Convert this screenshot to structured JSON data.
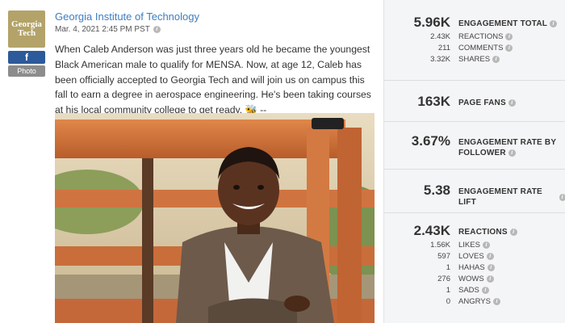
{
  "post": {
    "logo_line1": "Georgia",
    "logo_line2": "Tech",
    "network_badge": "f",
    "type_badge": "Photo",
    "org_name": "Georgia Institute of Technology",
    "timestamp": "Mar. 4, 2021 2:45 PM PST",
    "text": "When Caleb Anderson was just three years old he became the youngest Black American male to qualify for MENSA. Now, at age 12, Caleb has been officially accepted to Georgia Tech and will join us on campus this fall to earn a degree in aerospace engineering. He's been taking courses at his local community college to get ready. 🐝 -- http://c.gatech.edu/MeetCaleb",
    "photo_icon": "photo-of-smiling-boy"
  },
  "metrics": {
    "engagement_total": {
      "value": "5.96K",
      "label": "ENGAGEMENT TOTAL",
      "rows": [
        {
          "value": "2.43K",
          "label": "REACTIONS"
        },
        {
          "value": "211",
          "label": "COMMENTS"
        },
        {
          "value": "3.32K",
          "label": "SHARES"
        }
      ]
    },
    "page_fans": {
      "value": "163K",
      "label": "PAGE FANS"
    },
    "engagement_rate": {
      "value": "3.67%",
      "label_line1": "ENGAGEMENT RATE BY",
      "label_line2": "FOLLOWER"
    },
    "engagement_lift": {
      "value": "5.38",
      "label": "ENGAGEMENT RATE LIFT"
    },
    "reactions": {
      "value": "2.43K",
      "label": "REACTIONS",
      "rows": [
        {
          "value": "1.56K",
          "label": "LIKES"
        },
        {
          "value": "597",
          "label": "LOVES"
        },
        {
          "value": "1",
          "label": "HAHAS"
        },
        {
          "value": "276",
          "label": "WOWS"
        },
        {
          "value": "1",
          "label": "SADS"
        },
        {
          "value": "0",
          "label": "ANGRYS"
        }
      ]
    }
  },
  "colors": {
    "link": "#3e7cc0",
    "logo_gold": "#b3a369",
    "facebook_blue": "#2d5a9a",
    "panel_bg": "#f4f5f6"
  }
}
